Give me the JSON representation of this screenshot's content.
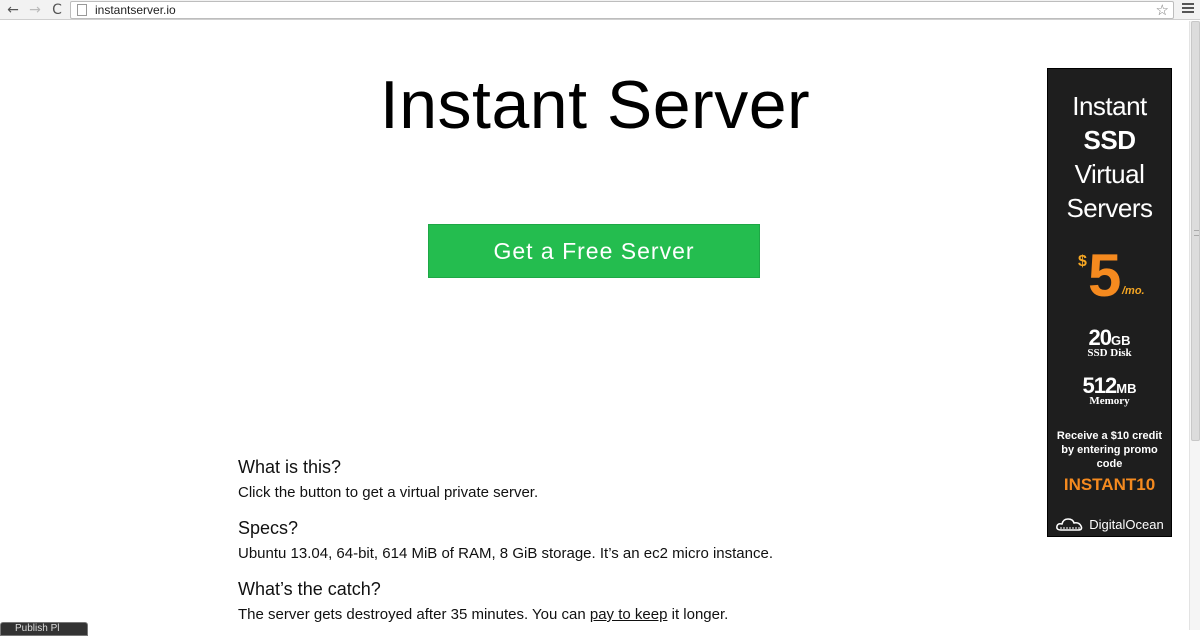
{
  "browser": {
    "url": "instantserver.io",
    "back_glyph": "←",
    "forward_glyph": "→",
    "reload_glyph": "C",
    "star_glyph": "☆"
  },
  "page": {
    "title": "Instant Server",
    "cta_label": "Get a Free Server",
    "cta_color": "#24bd4f",
    "faq": [
      {
        "question": "What is this?",
        "answer": "Click the button to get a virtual private server."
      },
      {
        "question": "Specs?",
        "answer": "Ubuntu 13.04, 64-bit, 614 MiB of RAM, 8 GiB storage. It’s an ec2 micro instance."
      },
      {
        "question": "What’s the catch?",
        "answer_before": "The server gets destroyed after 35 minutes. You can ",
        "answer_link": "pay to keep",
        "answer_after": " it longer."
      }
    ]
  },
  "ad": {
    "line1": "Instant",
    "line2": "SSD",
    "line3": "Virtual",
    "line4": "Servers",
    "price_currency": "$",
    "price_value": "5",
    "price_period": "/mo.",
    "disk_amount": "20",
    "disk_unit": "GB",
    "disk_label": "SSD Disk",
    "memory_amount": "512",
    "memory_unit": "MB",
    "memory_label": "Memory",
    "promo_text": "Receive a $10 credit by entering promo code",
    "promo_code": "INSTANT10",
    "brand": "DigitalOcean",
    "accent_color": "#f58a1f"
  },
  "popup_tab": {
    "label": "Publish Pl"
  }
}
